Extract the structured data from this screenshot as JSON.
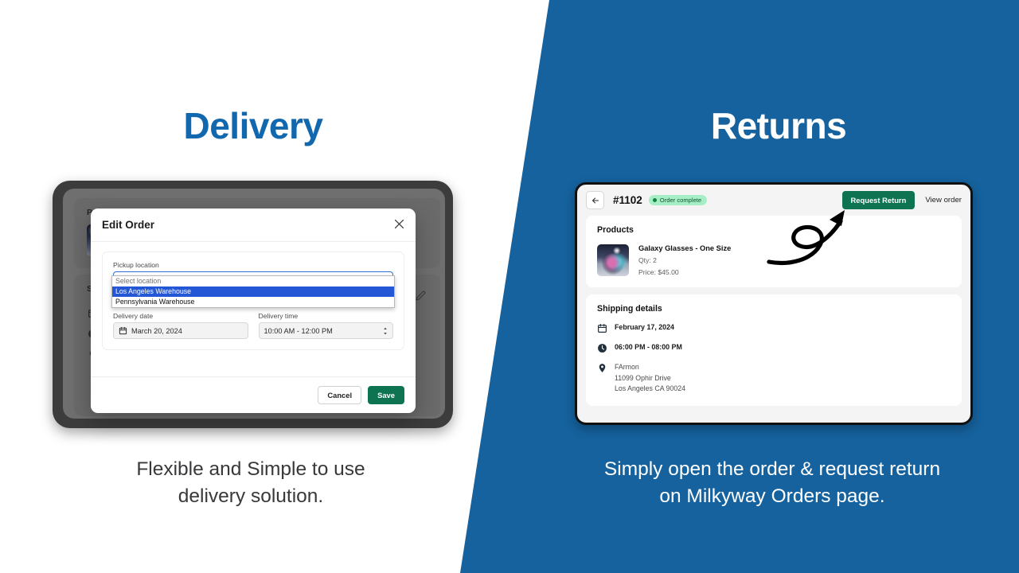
{
  "theme": {
    "brand_blue": "#15629E",
    "heading_blue": "#1268AE",
    "accent_green": "#0E7350",
    "badge_green_bg": "#A6EFC6",
    "badge_green_text": "#15803d",
    "dropdown_highlight": "#2457d6"
  },
  "left": {
    "headline": "Delivery",
    "caption": "Flexible and Simple to use\ndelivery solution.",
    "background_app": {
      "products_title": "Products",
      "shipping_title": "Ship",
      "edit_icon": "pencil-icon",
      "icons": [
        "calendar-icon",
        "clock-icon",
        "map-pin-icon"
      ]
    },
    "modal": {
      "title": "Edit Order",
      "close_icon": "close-icon",
      "pickup": {
        "label": "Pickup location",
        "value": "Los Angeles Warehouse",
        "options": [
          {
            "label": "Select location",
            "state": "placeholder"
          },
          {
            "label": "Los Angeles Warehouse",
            "state": "selected"
          },
          {
            "label": "Pennsylvania Warehouse",
            "state": "normal"
          }
        ]
      },
      "delivery_date": {
        "label": "Delivery date",
        "value": "March 20, 2024",
        "icon": "calendar-icon"
      },
      "delivery_time": {
        "label": "Delivery time",
        "value": "10:00 AM - 12:00 PM"
      },
      "cancel_label": "Cancel",
      "save_label": "Save"
    }
  },
  "right": {
    "headline": "Returns",
    "caption": "Simply open the order & request return\non Milkyway Orders page.",
    "order": {
      "back_icon": "arrow-left-icon",
      "number": "#1102",
      "status": "Order complete",
      "request_return_label": "Request Return",
      "view_order_label": "View order",
      "products": {
        "title": "Products",
        "items": [
          {
            "name": "Galaxy Glasses - One Size",
            "qty": "Qty: 2",
            "price": "Price: $45.00"
          }
        ]
      },
      "shipping": {
        "title": "Shipping details",
        "date": "February 17, 2024",
        "time": "06:00 PM - 08:00 PM",
        "recipient": "FArmon",
        "address_line1": "11099 Ophir Drive",
        "address_line2": "Los Angeles CA 90024"
      }
    },
    "annotation": "curved-arrow-icon"
  }
}
